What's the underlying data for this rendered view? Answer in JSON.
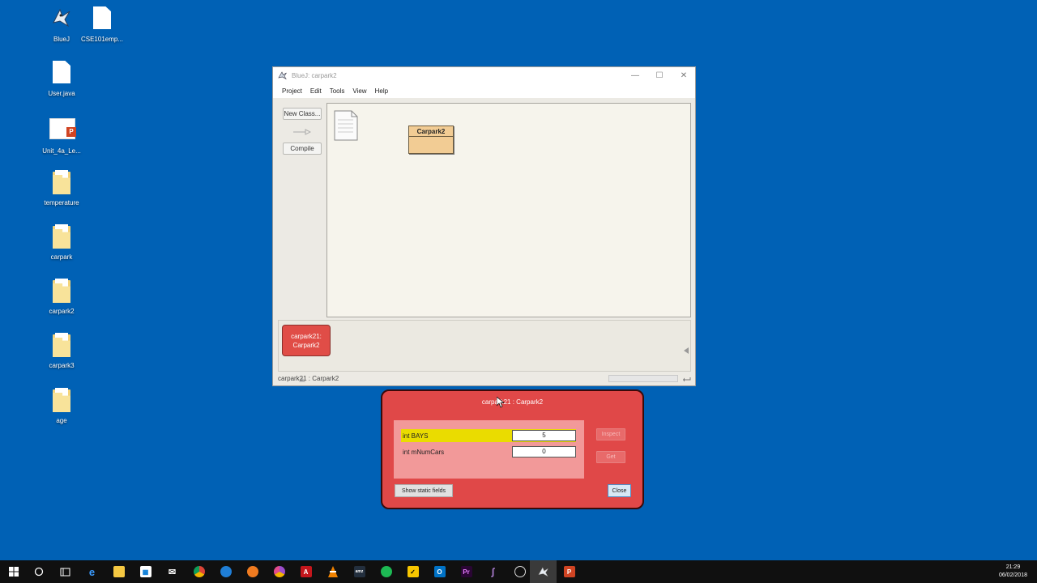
{
  "desktop": {
    "icons": [
      {
        "label": "BlueJ",
        "icon": "bluej-app-icon"
      },
      {
        "label": "CSE101emp...",
        "icon": "document-icon"
      },
      {
        "label": "User.java",
        "icon": "document-icon"
      },
      {
        "label": "Unit_4a_Le...",
        "icon": "powerpoint-file-icon"
      },
      {
        "label": "temperature",
        "icon": "folder-icon"
      },
      {
        "label": "carpark",
        "icon": "folder-icon"
      },
      {
        "label": "carpark2",
        "icon": "folder-icon"
      },
      {
        "label": "carpark3",
        "icon": "folder-icon"
      },
      {
        "label": "age",
        "icon": "folder-icon"
      }
    ]
  },
  "bluej": {
    "title": "BlueJ:  carpark2",
    "menu": [
      "Project",
      "Edit",
      "Tools",
      "View",
      "Help"
    ],
    "sidebar": {
      "new_class": "New Class...",
      "compile": "Compile"
    },
    "class_diagram": {
      "class_name": "Carpark2"
    },
    "object_bench": {
      "object_line1": "carpark21:",
      "object_line2": "Carpark2"
    },
    "status": "carpark21 : Carpark2"
  },
  "inspector": {
    "title": "carpark21 : Carpark2",
    "fields": [
      {
        "name": "int BAYS",
        "value": "5",
        "selected": true
      },
      {
        "name": "int mNumCars",
        "value": "0",
        "selected": false
      }
    ],
    "inspect_label": "Inspect",
    "get_label": "Get",
    "show_static_label": "Show static fields",
    "close_label": "Close"
  },
  "taskbar": {
    "apps": [
      "start",
      "search",
      "task-view",
      "edge",
      "file-explorer",
      "store",
      "mail",
      "chrome",
      "thunderbird",
      "firefox",
      "chrome-alt",
      "acrobat",
      "vlc",
      "amazon",
      "spotify",
      "norton",
      "outlook",
      "premiere",
      "visual-studio",
      "obs",
      "bluej",
      "powerpoint"
    ],
    "time": "21:29",
    "date": "06/02/2018"
  },
  "colors": {
    "desktop": "#0061b5",
    "object_red": "#e04848",
    "class_tan": "#f2cc94",
    "field_highlight": "#eadc00"
  }
}
